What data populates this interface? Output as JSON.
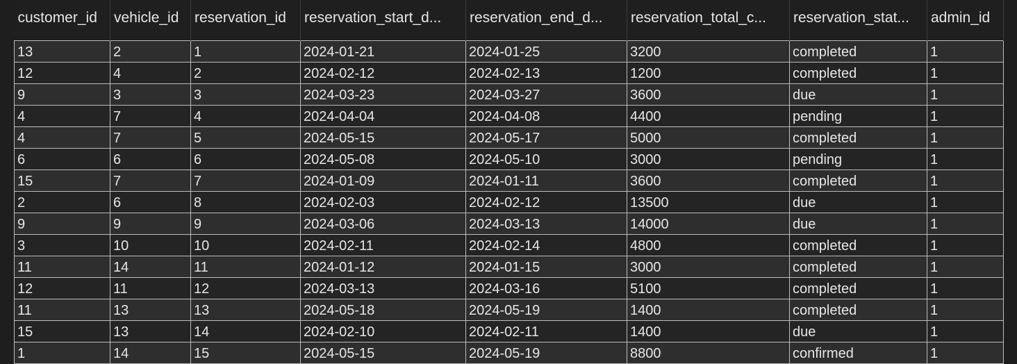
{
  "columns": [
    "customer_id",
    "vehicle_id",
    "reservation_id",
    "reservation_start_d...",
    "reservation_end_d...",
    "reservation_total_c...",
    "reservation_stat...",
    "admin_id"
  ],
  "rows": [
    [
      "13",
      "2",
      "1",
      "2024-01-21",
      "2024-01-25",
      "3200",
      "completed",
      "1"
    ],
    [
      "12",
      "4",
      "2",
      "2024-02-12",
      "2024-02-13",
      "1200",
      "completed",
      "1"
    ],
    [
      "9",
      "3",
      "3",
      "2024-03-23",
      "2024-03-27",
      "3600",
      "due",
      "1"
    ],
    [
      "4",
      "7",
      "4",
      "2024-04-04",
      "2024-04-08",
      "4400",
      "pending",
      "1"
    ],
    [
      "4",
      "7",
      "5",
      "2024-05-15",
      "2024-05-17",
      "5000",
      "completed",
      "1"
    ],
    [
      "6",
      "6",
      "6",
      "2024-05-08",
      "2024-05-10",
      "3000",
      "pending",
      "1"
    ],
    [
      "15",
      "7",
      "7",
      "2024-01-09",
      "2024-01-11",
      "3600",
      "completed",
      "1"
    ],
    [
      "2",
      "6",
      "8",
      "2024-02-03",
      "2024-02-12",
      "13500",
      "due",
      "1"
    ],
    [
      "9",
      "9",
      "9",
      "2024-03-06",
      "2024-03-13",
      "14000",
      "due",
      "1"
    ],
    [
      "3",
      "10",
      "10",
      "2024-02-11",
      "2024-02-14",
      "4800",
      "completed",
      "1"
    ],
    [
      "11",
      "14",
      "11",
      "2024-01-12",
      "2024-01-15",
      "3000",
      "completed",
      "1"
    ],
    [
      "12",
      "11",
      "12",
      "2024-03-13",
      "2024-03-16",
      "5100",
      "completed",
      "1"
    ],
    [
      "11",
      "13",
      "13",
      "2024-05-18",
      "2024-05-19",
      "1400",
      "completed",
      "1"
    ],
    [
      "15",
      "13",
      "14",
      "2024-02-10",
      "2024-02-11",
      "1400",
      "due",
      "1"
    ],
    [
      "1",
      "14",
      "15",
      "2024-05-15",
      "2024-05-19",
      "8800",
      "confirmed",
      "1"
    ]
  ],
  "null_label": "NULL"
}
